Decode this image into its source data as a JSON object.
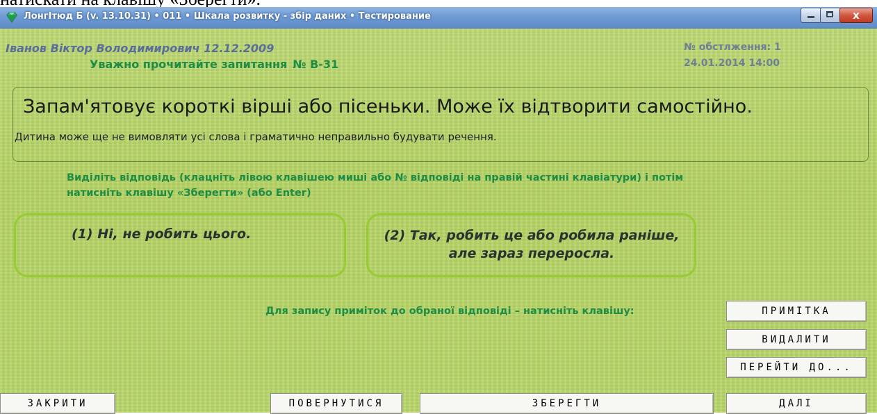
{
  "cutoff_text": "натискати на клавішу «Зберегти».",
  "window": {
    "title": "ЛонгІтюд Б (v. 13.10.31)  •  011  •  Шкала розвитку - збір даних  •  Тестирование",
    "controls": {
      "minimize": "minimize",
      "maximize": "maximize",
      "close": "x"
    }
  },
  "header": {
    "patient": "Іванов Віктор Володимирович  12.12.2009",
    "read_prompt": "Уважно прочитайте запитання",
    "question_number": "№ В-31",
    "exam_number": "№ обстлження: 1",
    "exam_datetime": "24.01.2014  14:00"
  },
  "question": {
    "main": "Запам'ятовує короткі вірші або пісеньки. Може їх відтворити самостійно.",
    "note": "Дитина може ще не вимовляти усі слова і граматично неправильно будувати речення."
  },
  "instruction": "Виділіть відповідь (клацніть лівою клавішею миші або № відповіді на правій частині клавіатури) і потім натисніть клавішу «Зберегти» (або Enter)",
  "answers": [
    {
      "label": "(1)  Ні,  не робить цього."
    },
    {
      "label": "(2)  Так,  робить це або робила раніше, але зараз переросла."
    }
  ],
  "notes_prompt": "Для запису приміток до обраної відповіді – натисніть клавішу:",
  "buttons": {
    "note": "ПРИМІТКА",
    "delete": "ВИДАЛИТИ",
    "goto": "ПЕРЕЙТИ ДО...",
    "close": "ЗАКРИТИ",
    "back": "ПОВЕРНУТИСЯ",
    "save": "ЗБЕРЕГТИ",
    "next": "ДАЛІ"
  },
  "colors": {
    "background": "#b9d76a",
    "accent_green": "#1e8c44",
    "patient_blue": "#5a6c9a",
    "answer_border": "#96cc32"
  },
  "icons": {
    "app": "gem-icon"
  }
}
